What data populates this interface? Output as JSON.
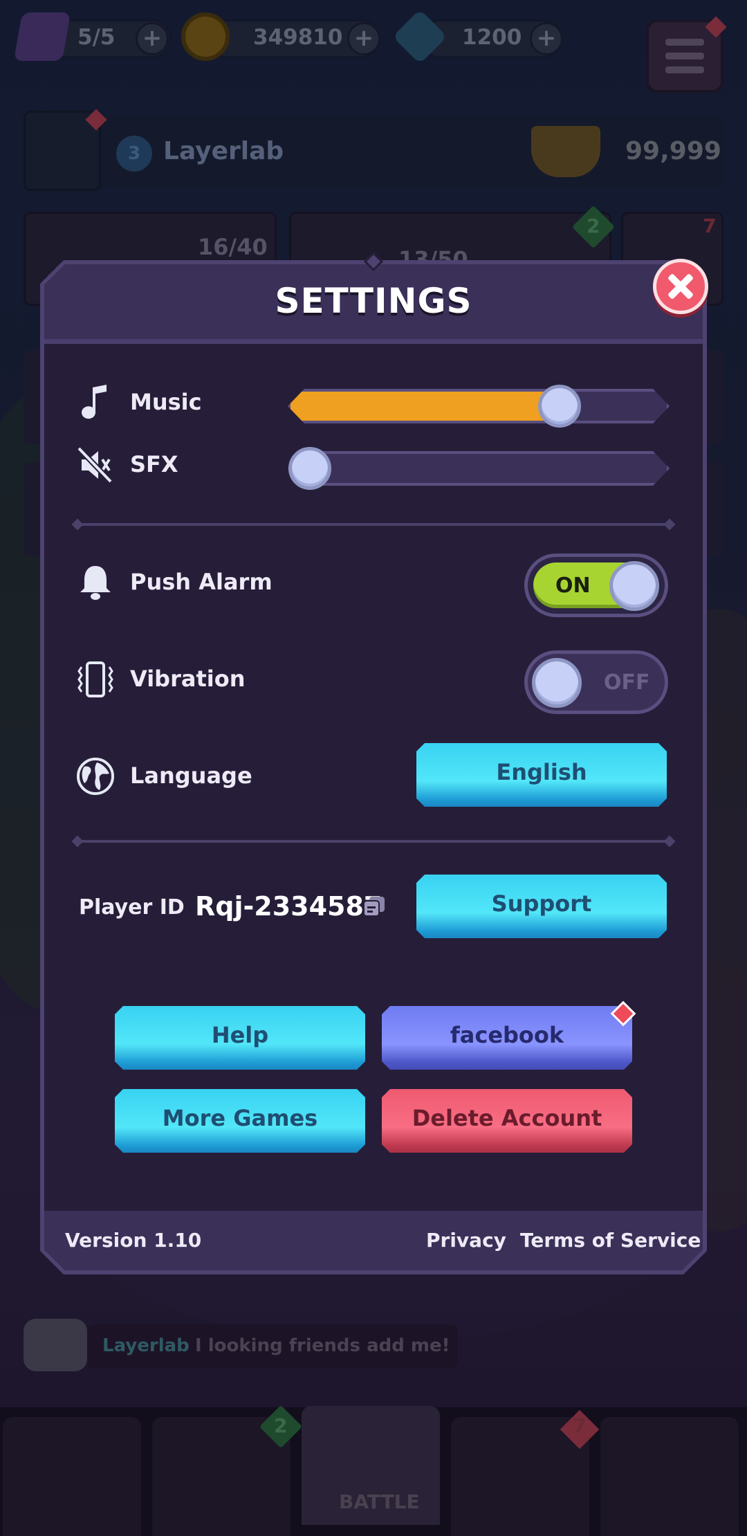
{
  "background": {
    "energy": "5/5",
    "coins": "349810",
    "gems": "1200",
    "profile": {
      "level": "3",
      "name": "Layerlab",
      "trophies": "99,999"
    },
    "cards": {
      "chest_progress": "16/40",
      "second_progress": "13/50",
      "badge_green": "2",
      "badge_red": "7"
    },
    "chat": {
      "name": "Layerlab",
      "message": "I looking friends add me!"
    },
    "nav": {
      "active_label": "BATTLE",
      "badge_green": "2",
      "badge_red": "7"
    }
  },
  "settings": {
    "title": "SETTINGS",
    "music": {
      "label": "Music",
      "level": 0.74
    },
    "sfx": {
      "label": "SFX",
      "level": 0.0
    },
    "push_alarm": {
      "label": "Push Alarm",
      "state": "ON"
    },
    "vibration": {
      "label": "Vibration",
      "state": "OFF"
    },
    "language": {
      "label": "Language",
      "value": "English"
    },
    "player": {
      "label": "Player ID",
      "id": "Rqj-2334587"
    },
    "buttons": {
      "support": "Support",
      "help": "Help",
      "facebook": "facebook",
      "more_games": "More Games",
      "delete_account": "Delete Account"
    },
    "footer": {
      "version": "Version 1.10",
      "privacy": "Privacy",
      "terms": "Terms of Service"
    }
  },
  "colors": {
    "accent_orange": "#f0a020",
    "toggle_on": "#a8d432",
    "button_cyan": "#52e6f8",
    "button_blue": "#8a94ff",
    "button_red": "#f86e84",
    "close_red": "#f05a6c"
  },
  "icons": {
    "music": "music-note-icon",
    "sfx": "speaker-muted-icon",
    "push": "bell-icon",
    "vibration": "phone-vibrate-icon",
    "language": "globe-icon",
    "copy": "copy-icon",
    "close": "close-icon"
  }
}
